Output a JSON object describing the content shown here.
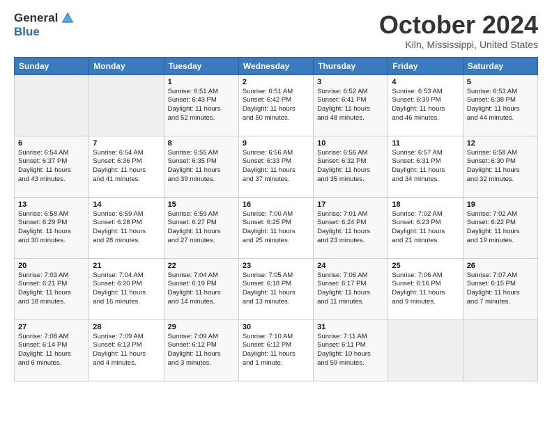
{
  "header": {
    "logo_general": "General",
    "logo_blue": "Blue",
    "title": "October 2024",
    "location": "Kiln, Mississippi, United States"
  },
  "weekdays": [
    "Sunday",
    "Monday",
    "Tuesday",
    "Wednesday",
    "Thursday",
    "Friday",
    "Saturday"
  ],
  "weeks": [
    [
      {
        "day": "",
        "info": ""
      },
      {
        "day": "",
        "info": ""
      },
      {
        "day": "1",
        "info": "Sunrise: 6:51 AM\nSunset: 6:43 PM\nDaylight: 11 hours\nand 52 minutes."
      },
      {
        "day": "2",
        "info": "Sunrise: 6:51 AM\nSunset: 6:42 PM\nDaylight: 11 hours\nand 50 minutes."
      },
      {
        "day": "3",
        "info": "Sunrise: 6:52 AM\nSunset: 6:41 PM\nDaylight: 11 hours\nand 48 minutes."
      },
      {
        "day": "4",
        "info": "Sunrise: 6:53 AM\nSunset: 6:39 PM\nDaylight: 11 hours\nand 46 minutes."
      },
      {
        "day": "5",
        "info": "Sunrise: 6:53 AM\nSunset: 6:38 PM\nDaylight: 11 hours\nand 44 minutes."
      }
    ],
    [
      {
        "day": "6",
        "info": "Sunrise: 6:54 AM\nSunset: 6:37 PM\nDaylight: 11 hours\nand 43 minutes."
      },
      {
        "day": "7",
        "info": "Sunrise: 6:54 AM\nSunset: 6:36 PM\nDaylight: 11 hours\nand 41 minutes."
      },
      {
        "day": "8",
        "info": "Sunrise: 6:55 AM\nSunset: 6:35 PM\nDaylight: 11 hours\nand 39 minutes."
      },
      {
        "day": "9",
        "info": "Sunrise: 6:56 AM\nSunset: 6:33 PM\nDaylight: 11 hours\nand 37 minutes."
      },
      {
        "day": "10",
        "info": "Sunrise: 6:56 AM\nSunset: 6:32 PM\nDaylight: 11 hours\nand 35 minutes."
      },
      {
        "day": "11",
        "info": "Sunrise: 6:57 AM\nSunset: 6:31 PM\nDaylight: 11 hours\nand 34 minutes."
      },
      {
        "day": "12",
        "info": "Sunrise: 6:58 AM\nSunset: 6:30 PM\nDaylight: 11 hours\nand 32 minutes."
      }
    ],
    [
      {
        "day": "13",
        "info": "Sunrise: 6:58 AM\nSunset: 6:29 PM\nDaylight: 11 hours\nand 30 minutes."
      },
      {
        "day": "14",
        "info": "Sunrise: 6:59 AM\nSunset: 6:28 PM\nDaylight: 11 hours\nand 28 minutes."
      },
      {
        "day": "15",
        "info": "Sunrise: 6:59 AM\nSunset: 6:27 PM\nDaylight: 11 hours\nand 27 minutes."
      },
      {
        "day": "16",
        "info": "Sunrise: 7:00 AM\nSunset: 6:25 PM\nDaylight: 11 hours\nand 25 minutes."
      },
      {
        "day": "17",
        "info": "Sunrise: 7:01 AM\nSunset: 6:24 PM\nDaylight: 11 hours\nand 23 minutes."
      },
      {
        "day": "18",
        "info": "Sunrise: 7:02 AM\nSunset: 6:23 PM\nDaylight: 11 hours\nand 21 minutes."
      },
      {
        "day": "19",
        "info": "Sunrise: 7:02 AM\nSunset: 6:22 PM\nDaylight: 11 hours\nand 19 minutes."
      }
    ],
    [
      {
        "day": "20",
        "info": "Sunrise: 7:03 AM\nSunset: 6:21 PM\nDaylight: 11 hours\nand 18 minutes."
      },
      {
        "day": "21",
        "info": "Sunrise: 7:04 AM\nSunset: 6:20 PM\nDaylight: 11 hours\nand 16 minutes."
      },
      {
        "day": "22",
        "info": "Sunrise: 7:04 AM\nSunset: 6:19 PM\nDaylight: 11 hours\nand 14 minutes."
      },
      {
        "day": "23",
        "info": "Sunrise: 7:05 AM\nSunset: 6:18 PM\nDaylight: 11 hours\nand 13 minutes."
      },
      {
        "day": "24",
        "info": "Sunrise: 7:06 AM\nSunset: 6:17 PM\nDaylight: 11 hours\nand 11 minutes."
      },
      {
        "day": "25",
        "info": "Sunrise: 7:06 AM\nSunset: 6:16 PM\nDaylight: 11 hours\nand 9 minutes."
      },
      {
        "day": "26",
        "info": "Sunrise: 7:07 AM\nSunset: 6:15 PM\nDaylight: 11 hours\nand 7 minutes."
      }
    ],
    [
      {
        "day": "27",
        "info": "Sunrise: 7:08 AM\nSunset: 6:14 PM\nDaylight: 11 hours\nand 6 minutes."
      },
      {
        "day": "28",
        "info": "Sunrise: 7:09 AM\nSunset: 6:13 PM\nDaylight: 11 hours\nand 4 minutes."
      },
      {
        "day": "29",
        "info": "Sunrise: 7:09 AM\nSunset: 6:12 PM\nDaylight: 11 hours\nand 3 minutes."
      },
      {
        "day": "30",
        "info": "Sunrise: 7:10 AM\nSunset: 6:12 PM\nDaylight: 11 hours\nand 1 minute."
      },
      {
        "day": "31",
        "info": "Sunrise: 7:11 AM\nSunset: 6:11 PM\nDaylight: 10 hours\nand 59 minutes."
      },
      {
        "day": "",
        "info": ""
      },
      {
        "day": "",
        "info": ""
      }
    ]
  ]
}
